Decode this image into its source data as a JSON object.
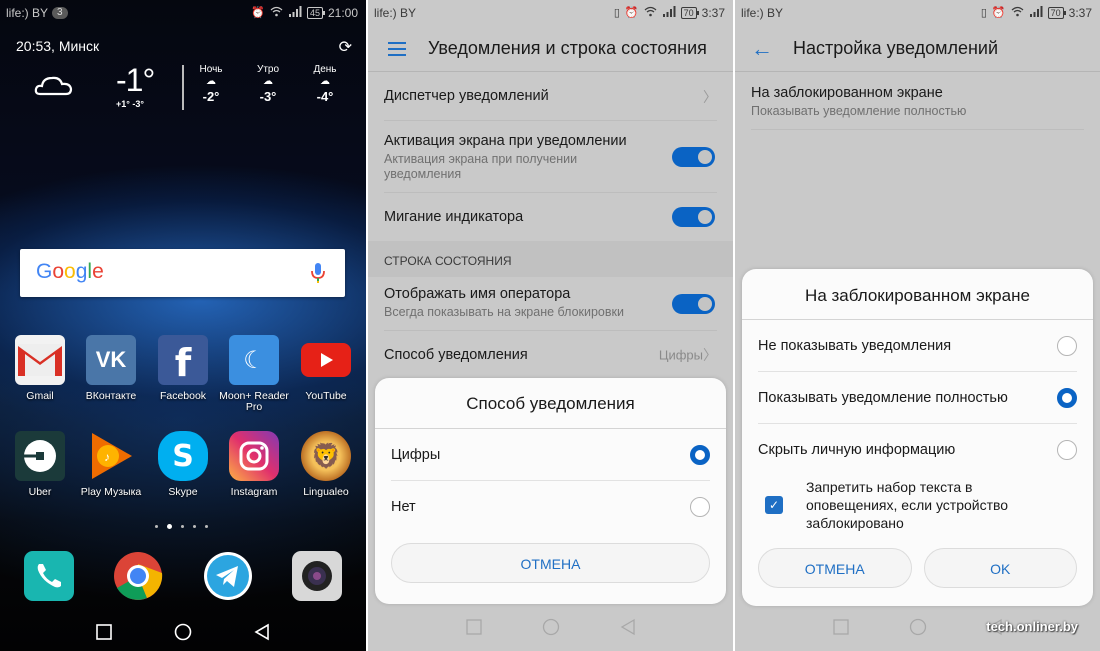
{
  "screens": {
    "home": {
      "status": {
        "carrier": "life:) BY",
        "badge": "3",
        "battery": "45",
        "time": "21:00"
      },
      "weather": {
        "location": "20:53, Минск",
        "current_temp": "-1°",
        "range": "+1° -3°",
        "forecast": [
          {
            "label": "Ночь",
            "temp": "-2°"
          },
          {
            "label": "Утро",
            "temp": "-3°"
          },
          {
            "label": "День",
            "temp": "-4°"
          }
        ]
      },
      "search": {
        "logo": "Google"
      },
      "apps_row1": [
        {
          "name": "Gmail",
          "color": "#ffffff"
        },
        {
          "name": "ВКонтакте",
          "color": "#4a76a8"
        },
        {
          "name": "Facebook",
          "color": "#3b5998"
        },
        {
          "name": "Moon+ Reader Pro",
          "color": "#3b8fe0"
        },
        {
          "name": "YouTube",
          "color": "#e62117"
        }
      ],
      "apps_row2": [
        {
          "name": "Uber",
          "color": "#1b3a3a"
        },
        {
          "name": "Play Музыка",
          "color": "#ff9800"
        },
        {
          "name": "Skype",
          "color": "#00aff0"
        },
        {
          "name": "Instagram",
          "color": "#d6249f"
        },
        {
          "name": "Lingualeo",
          "color": "#d98a1e"
        }
      ],
      "page_indicator": {
        "pages": 5,
        "current": 2
      },
      "dock": [
        "Телефон",
        "Chrome",
        "Telegram",
        "Камера"
      ]
    },
    "notifications": {
      "status": {
        "carrier": "life:) BY",
        "battery": "70",
        "time": "3:37"
      },
      "title": "Уведомления и строка состояния",
      "rows": [
        {
          "title": "Диспетчер уведомлений"
        },
        {
          "title": "Активация экрана при уведомлении",
          "subtitle": "Активация экрана при получении уведомления",
          "toggle": true
        },
        {
          "title": "Мигание индикатора",
          "toggle": true
        }
      ],
      "section_header": "СТРОКА СОСТОЯНИЯ",
      "rows2": [
        {
          "title": "Отображать имя оператора",
          "subtitle": "Всегда показывать на экране блокировки",
          "toggle": true
        },
        {
          "title": "Способ уведомления",
          "value": "Цифры"
        }
      ],
      "dialog": {
        "title": "Способ уведомления",
        "options": [
          {
            "label": "Цифры",
            "selected": true
          },
          {
            "label": "Нет",
            "selected": false
          }
        ],
        "cancel": "ОТМЕНА"
      }
    },
    "notification_settings": {
      "status": {
        "carrier": "life:) BY",
        "battery": "70",
        "time": "3:37"
      },
      "title": "Настройка уведомлений",
      "row": {
        "title": "На заблокированном экране",
        "subtitle": "Показывать уведомление полностью"
      },
      "dialog": {
        "title": "На заблокированном экране",
        "options": [
          {
            "label": "Не показывать уведомления",
            "selected": false
          },
          {
            "label": "Показывать уведомление полностью",
            "selected": true
          },
          {
            "label": "Скрыть личную информацию",
            "selected": false
          }
        ],
        "checkbox": {
          "label": "Запретить набор текста в оповещениях, если устройство заблокировано",
          "checked": true
        },
        "cancel": "ОТМЕНА",
        "ok": "OK"
      }
    }
  },
  "watermark": "tech.onliner.by",
  "colors": {
    "accent": "#0a63c4",
    "settings_bg": "#c9c9c9",
    "dialog_bg": "#fbfbfb"
  }
}
